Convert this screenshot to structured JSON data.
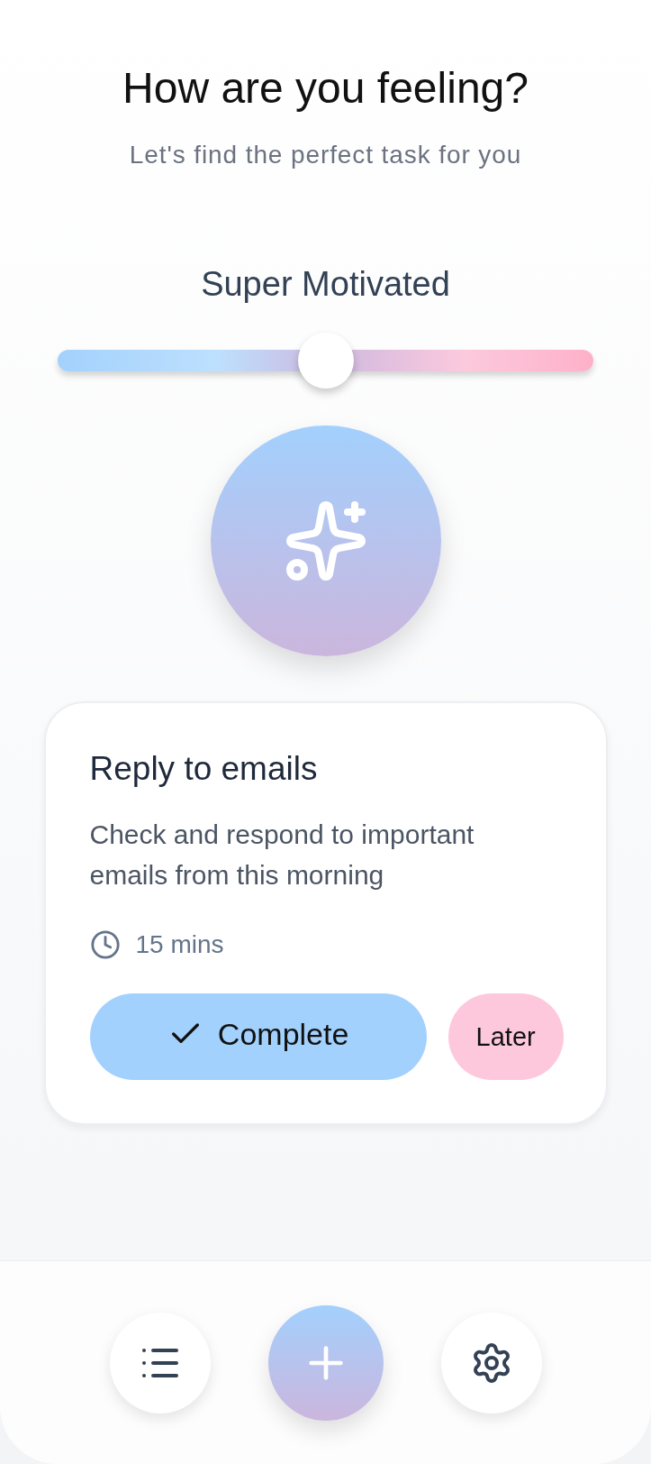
{
  "header": {
    "title": "How are you feeling?",
    "subtitle": "Let's find the perfect task for you"
  },
  "mood": {
    "label": "Super Motivated",
    "level": 0.5
  },
  "task": {
    "title": "Reply to emails",
    "description": "Check and respond to important emails from this morning",
    "duration": "15 mins"
  },
  "actions": [
    {
      "kind": "primary",
      "label": "Complete"
    },
    {
      "kind": "secondary",
      "label": "Later"
    }
  ]
}
